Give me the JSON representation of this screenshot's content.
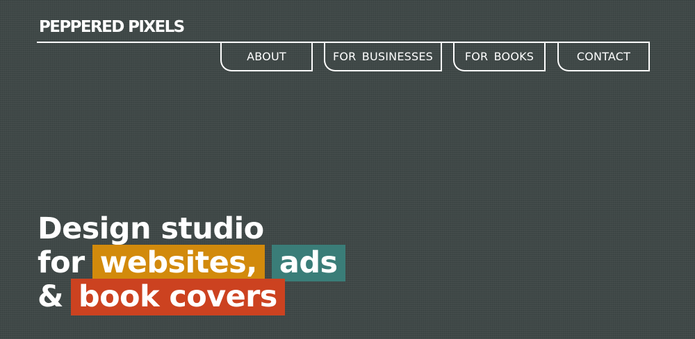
{
  "brand": {
    "logo_text": "PEPPERED PIXELS"
  },
  "nav": {
    "items": [
      {
        "label": "ABOUT"
      },
      {
        "label": "FOR BUSINESSES"
      },
      {
        "label": "FOR BOOKS"
      },
      {
        "label": "CONTACT"
      }
    ]
  },
  "hero": {
    "line1": "Design studio",
    "line2_prefix": "for",
    "highlight_websites": "websites,",
    "highlight_ads": "ads",
    "line3_prefix": "&",
    "highlight_book_covers": "book covers"
  },
  "colors": {
    "background": "#3f4847",
    "text": "#ffffff",
    "highlight_orange": "#d28a0c",
    "highlight_teal": "#3a7d78",
    "highlight_red": "#cc4220"
  }
}
